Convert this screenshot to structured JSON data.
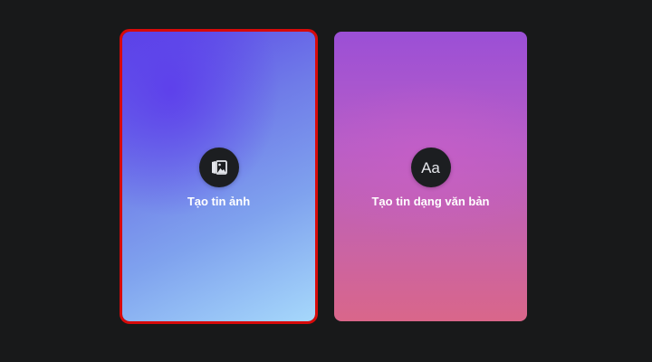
{
  "cards": {
    "photo": {
      "label": "Tạo tin ảnh",
      "icon": "photo-gallery-icon",
      "selected": true,
      "highlight_color": "#d70a0a"
    },
    "text": {
      "label": "Tạo tin dạng văn bản",
      "icon_text": "Aa",
      "icon": "text-aa-icon"
    }
  },
  "colors": {
    "background": "#18191a",
    "icon_circle": "#1c1e21",
    "photo_gradient": [
      "#5b45e6",
      "#a6d8fb"
    ],
    "text_gradient": [
      "#9b4fd6",
      "#d9668a"
    ]
  }
}
